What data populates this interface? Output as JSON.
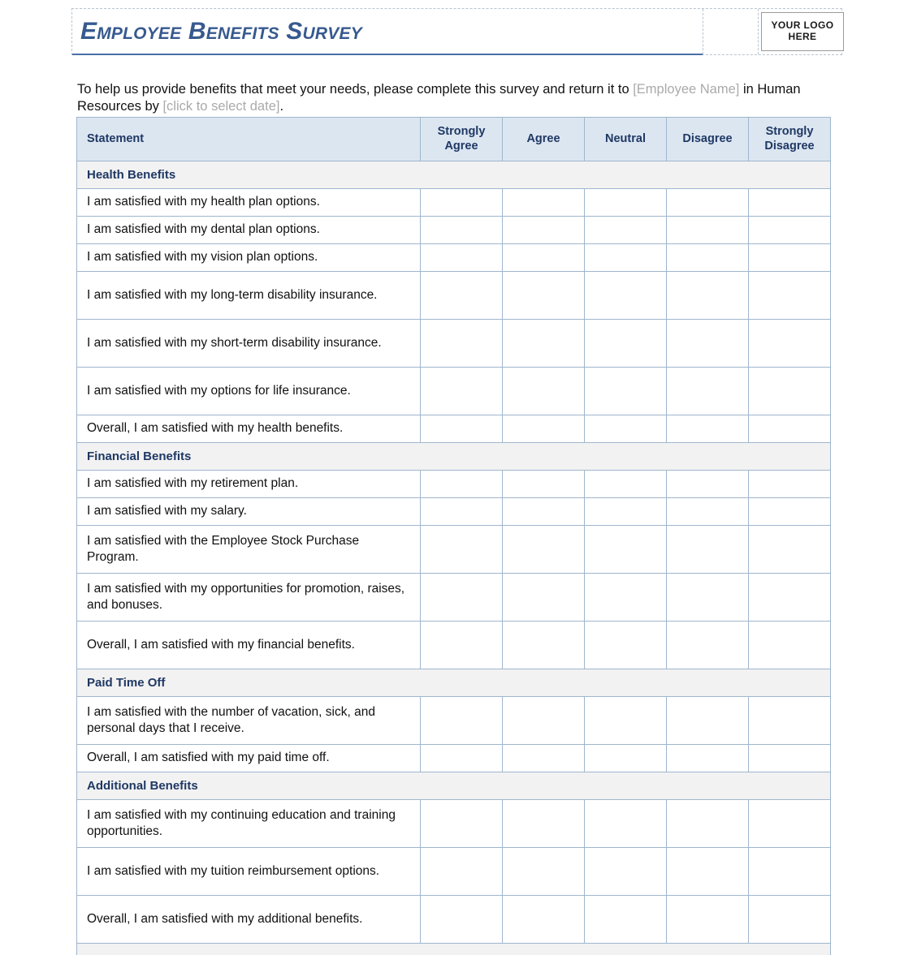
{
  "header": {
    "title": "Employee Benefits Survey",
    "logo": {
      "line1": "YOUR LOGO",
      "line2": "HERE"
    }
  },
  "intro": {
    "part1": "To help us provide benefits that meet your needs, please complete this survey and return it to ",
    "employee_name_placeholder": "[Employee Name]",
    "part2": " in Human Resources by ",
    "date_placeholder": "[click to select date]",
    "part3": "."
  },
  "table": {
    "columns": [
      "Statement",
      "Strongly Agree",
      "Agree",
      "Neutral",
      "Disagree",
      "Strongly Disagree"
    ],
    "sections": [
      {
        "title": "Health Benefits",
        "items": [
          "I am satisfied with my health plan options.",
          "I am satisfied with my dental plan options.",
          "I am satisfied with my vision plan options.",
          "I am satisfied with my long-term disability insurance.",
          "I am satisfied with my short-term disability insurance.",
          "I am satisfied with my options for life insurance.",
          "Overall, I am satisfied with my health benefits."
        ]
      },
      {
        "title": "Financial Benefits",
        "items": [
          "I am satisfied with my retirement plan.",
          "I am satisfied with my salary.",
          "I am satisfied with the Employee Stock Purchase Program.",
          "I am satisfied with my opportunities for promotion, raises, and bonuses.",
          "Overall, I am satisfied with my financial benefits."
        ]
      },
      {
        "title": "Paid Time Off",
        "items": [
          "I am satisfied with the number of vacation, sick, and personal days that I receive.",
          "Overall, I am satisfied with my paid time off."
        ]
      },
      {
        "title": "Additional Benefits",
        "items": [
          "I am satisfied with my continuing education and training opportunities.",
          "I am satisfied with my tuition reimbursement options.",
          "Overall, I am satisfied with my additional benefits."
        ]
      }
    ]
  },
  "colors": {
    "title_blue": "#37598f",
    "header_fill": "#dce6f1",
    "header_text": "#1f3864",
    "section_fill": "#f2f2f2",
    "grid_line": "#9fb6cd",
    "placeholder_gray": "#aaaaaa"
  }
}
